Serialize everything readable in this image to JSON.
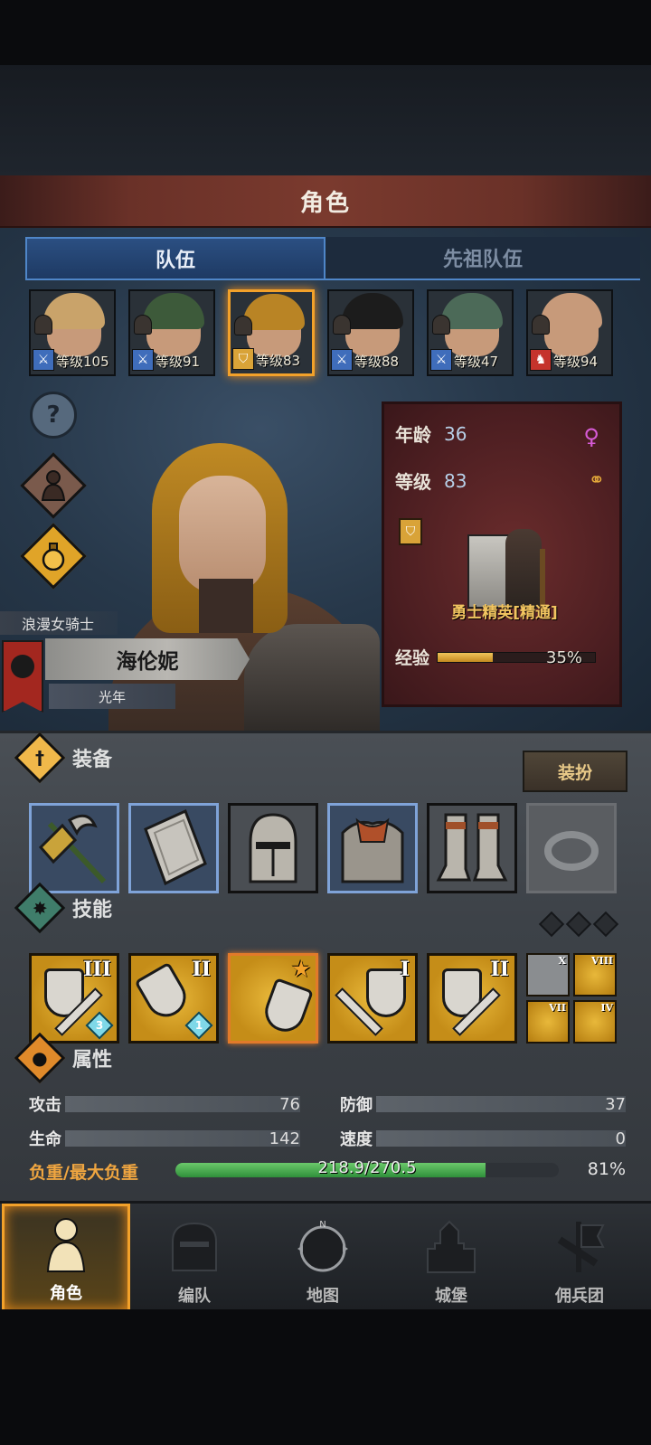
{
  "header": {
    "title": "角色"
  },
  "tabs": [
    {
      "label": "队伍",
      "active": true
    },
    {
      "label": "先祖队伍",
      "active": false
    }
  ],
  "heroes": [
    {
      "level_text": "等级105",
      "role": "sword",
      "role_color": "#3f6dbb",
      "hair": "#c9a36a",
      "selected": false
    },
    {
      "level_text": "等级91",
      "role": "sword",
      "role_color": "#3f6dbb",
      "hair": "#3d5a3a",
      "selected": false
    },
    {
      "level_text": "等级83",
      "role": "shield",
      "role_color": "#d9a338",
      "hair": "#b98425",
      "selected": true
    },
    {
      "level_text": "等级88",
      "role": "sword",
      "role_color": "#3f6dbb",
      "hair": "#1c1c1c",
      "selected": false
    },
    {
      "level_text": "等级47",
      "role": "sword",
      "role_color": "#3f6dbb",
      "hair": "#4c6a58",
      "selected": false
    },
    {
      "level_text": "等级94",
      "role": "horse",
      "role_color": "#c5332c",
      "hair": "#c79a7a",
      "selected": false
    }
  ],
  "side_buttons": [
    {
      "name": "help-icon",
      "glyph": "?"
    },
    {
      "name": "character-figure-icon",
      "glyph": ""
    },
    {
      "name": "potion-icon",
      "glyph": ""
    }
  ],
  "character": {
    "role_title": "浪漫女骑士",
    "name": "海伦妮",
    "title": "光年"
  },
  "info": {
    "age_label": "年龄",
    "age_value": "36",
    "level_label": "等级",
    "level_value": "83",
    "class_name": "勇士精英[精通]",
    "exp_label": "经验",
    "exp_percent_text": "35%",
    "exp_fraction": 0.35
  },
  "equipment": {
    "section_label": "装备",
    "dress_button": "装扮",
    "slots": [
      {
        "name": "axe-slot",
        "rarity": "rare"
      },
      {
        "name": "shield-slot",
        "rarity": "rare"
      },
      {
        "name": "helmet-slot",
        "rarity": "normal"
      },
      {
        "name": "armor-slot",
        "rarity": "rare"
      },
      {
        "name": "boots-slot",
        "rarity": "normal"
      },
      {
        "name": "ring-slot",
        "rarity": "empty"
      }
    ]
  },
  "skills": {
    "section_label": "技能",
    "items": [
      {
        "roman": "III",
        "gem": "3"
      },
      {
        "roman": "II",
        "gem": "1"
      },
      {
        "roman": "★",
        "gem": ""
      },
      {
        "roman": "I",
        "gem": ""
      },
      {
        "roman": "II",
        "gem": ""
      }
    ],
    "mini": [
      "X",
      "VIII",
      "VII",
      "IV"
    ]
  },
  "attributes": {
    "section_label": "属性",
    "attack_label": "攻击",
    "attack_value": "76",
    "defense_label": "防御",
    "defense_value": "37",
    "hp_label": "生命",
    "hp_value": "142",
    "speed_label": "速度",
    "speed_value": "0",
    "load_label": "负重/最大负重",
    "load_text": "218.9/270.5",
    "load_percent_text": "81%",
    "load_fraction": 0.81
  },
  "nav": [
    {
      "label": "角色",
      "active": true,
      "name": "nav-character"
    },
    {
      "label": "编队",
      "active": false,
      "name": "nav-formation"
    },
    {
      "label": "地图",
      "active": false,
      "name": "nav-map"
    },
    {
      "label": "城堡",
      "active": false,
      "name": "nav-castle"
    },
    {
      "label": "佣兵团",
      "active": false,
      "name": "nav-mercenary"
    }
  ]
}
